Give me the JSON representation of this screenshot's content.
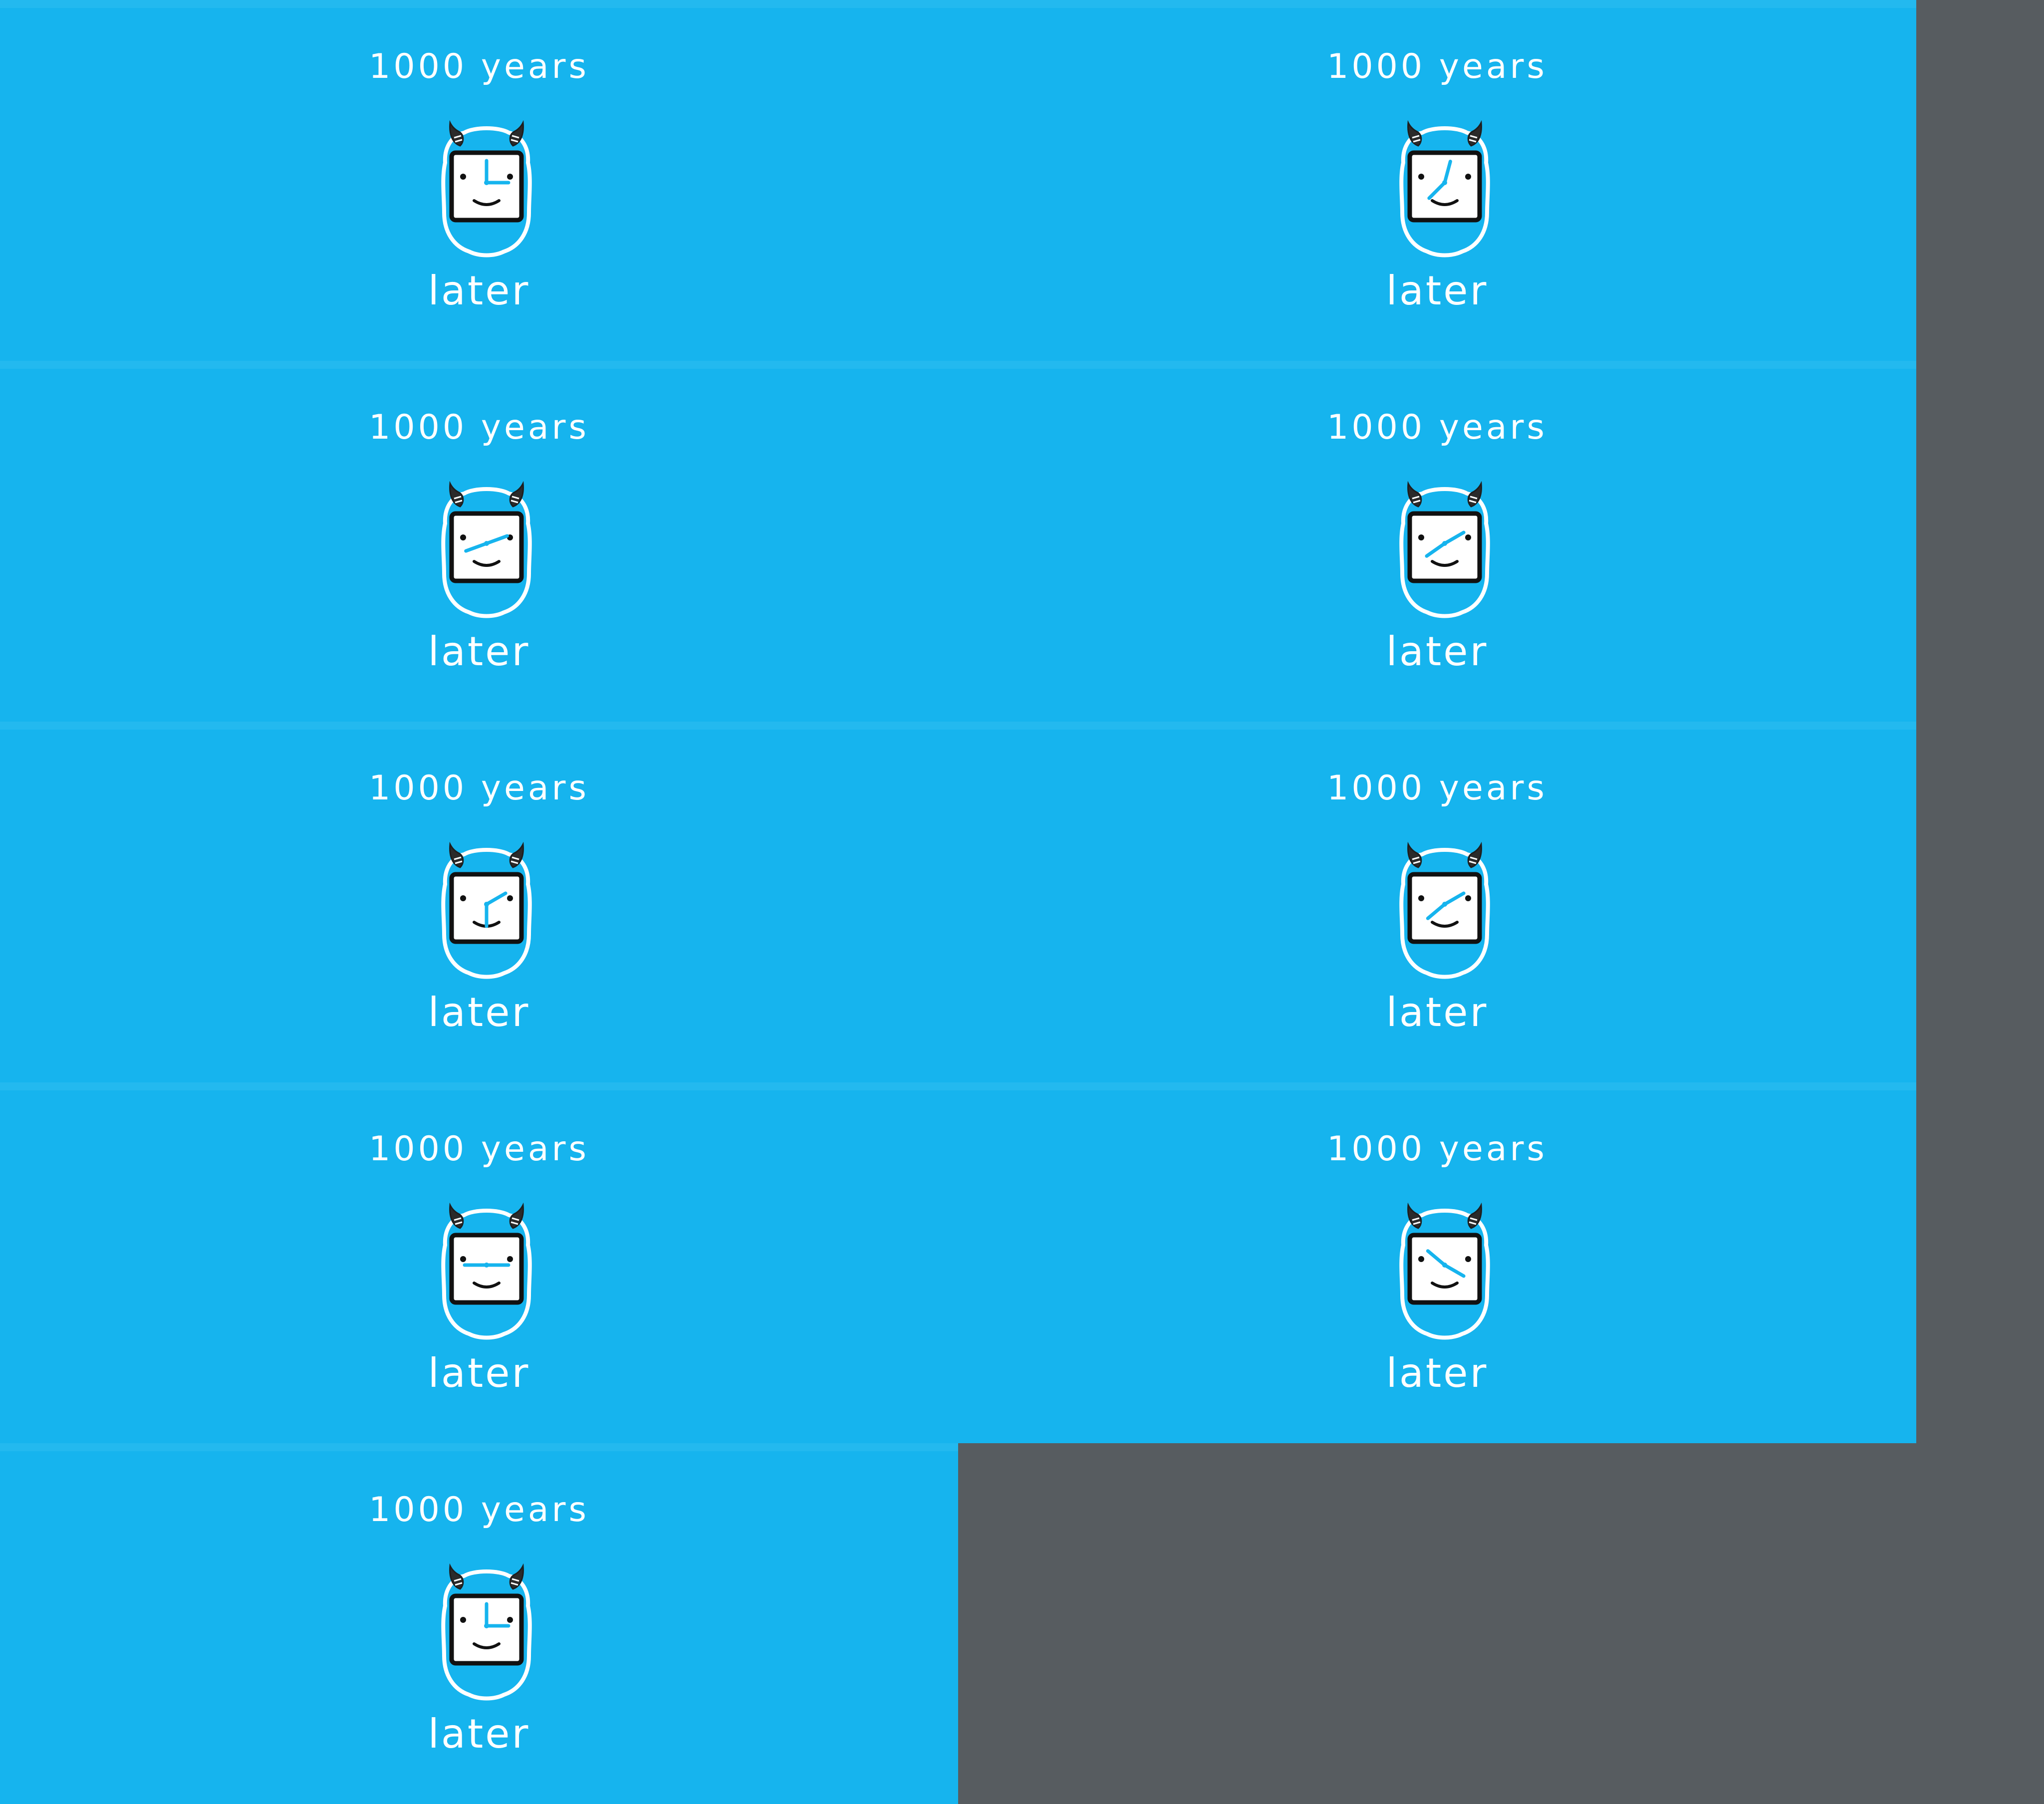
{
  "colors": {
    "frame_background": "#16b4ee",
    "frame_divider": "#23b9ef",
    "sheet_background": "#575c60",
    "caption_text": "#ffffff",
    "clock_hands": "#16b4ee",
    "horns": "#2b2b2b"
  },
  "frames": [
    {
      "caption_top": "1000 years",
      "caption_bottom": "later",
      "mascot_icon": "horned-clock-creature-icon",
      "clock_hour_deg": 0,
      "clock_minute_deg": 90
    },
    {
      "caption_top": "1000 years",
      "caption_bottom": "later",
      "mascot_icon": "horned-clock-creature-icon",
      "clock_hour_deg": 15,
      "clock_minute_deg": 225
    },
    {
      "caption_top": "1000 years",
      "caption_bottom": "later",
      "mascot_icon": "horned-clock-creature-icon",
      "clock_hour_deg": 250,
      "clock_minute_deg": 70
    },
    {
      "caption_top": "1000 years",
      "caption_bottom": "later",
      "mascot_icon": "horned-clock-creature-icon",
      "clock_hour_deg": 60,
      "clock_minute_deg": 235
    },
    {
      "caption_top": "1000 years",
      "caption_bottom": "later",
      "mascot_icon": "horned-clock-creature-icon",
      "clock_hour_deg": 180,
      "clock_minute_deg": 60
    },
    {
      "caption_top": "1000 years",
      "caption_bottom": "later",
      "mascot_icon": "horned-clock-creature-icon",
      "clock_hour_deg": 230,
      "clock_minute_deg": 60
    },
    {
      "caption_top": "1000 years",
      "caption_bottom": "later",
      "mascot_icon": "horned-clock-creature-icon",
      "clock_hour_deg": 270,
      "clock_minute_deg": 90
    },
    {
      "caption_top": "1000 years",
      "caption_bottom": "later",
      "mascot_icon": "horned-clock-creature-icon",
      "clock_hour_deg": 310,
      "clock_minute_deg": 120
    },
    {
      "caption_top": "1000 years",
      "caption_bottom": "later",
      "mascot_icon": "horned-clock-creature-icon",
      "clock_hour_deg": 0,
      "clock_minute_deg": 90
    }
  ]
}
